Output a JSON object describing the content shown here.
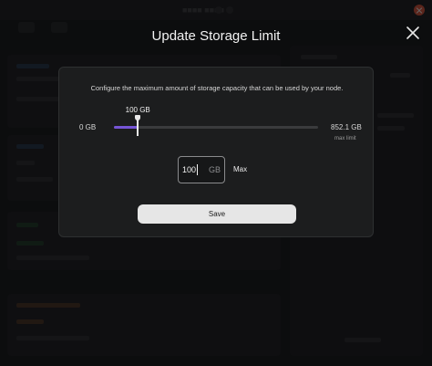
{
  "modal": {
    "title": "Update Storage Limit",
    "description": "Configure the maximum amount of storage capacity that can be used by your node.",
    "slider": {
      "min_label": "0 GB",
      "max_label": "852.1 GB",
      "max_sublabel": "max limit",
      "value_label": "100 GB",
      "value_fraction": 0.117
    },
    "amount": {
      "value": "100",
      "unit": "GB"
    },
    "max_button": "Max",
    "save_button": "Save"
  },
  "colors": {
    "accent": "#7655d6",
    "panel": "#1c1d1e",
    "close": "#e2563a"
  }
}
